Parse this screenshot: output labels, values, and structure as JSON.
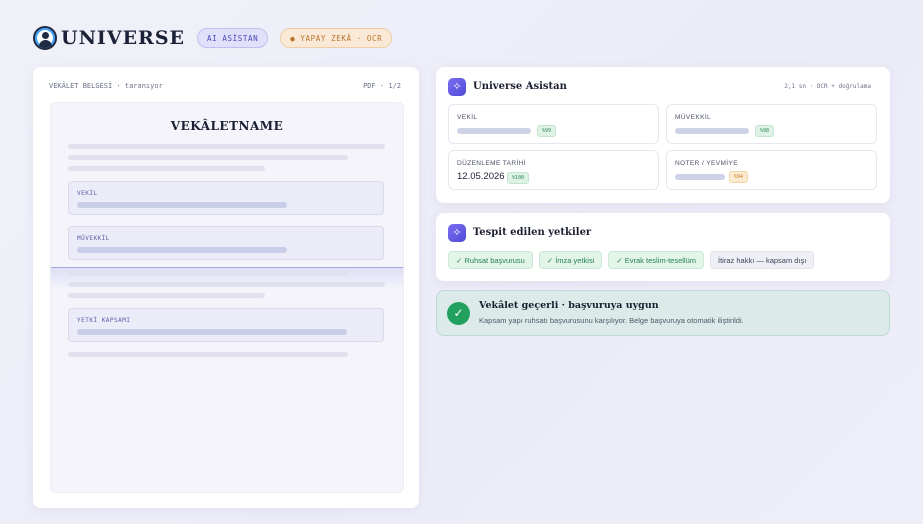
{
  "header": {
    "brand": "UNIVERSE",
    "badge_ai": "AI ASİSTAN",
    "badge_ocr": "● YAPAY ZEKÂ · OCR"
  },
  "document": {
    "status": "VEKÂLET BELGESİ · taranıyor",
    "pages": "PDF · 1/2",
    "title": "VEKÂLETNAME",
    "fields": [
      {
        "label": "VEKİL"
      },
      {
        "label": "MÜVEKKİL"
      },
      {
        "label": "YETKİ KAPSAMI"
      }
    ]
  },
  "assistant": {
    "title": "Universe Asistan",
    "meta": "2,1 sn · OCR + doğrulama",
    "icon": "sparkle-icon",
    "fields": [
      {
        "label": "VEKİL",
        "badge": "%99"
      },
      {
        "label": "MÜVEKKİL",
        "badge": "%98"
      },
      {
        "label": "DÜZENLEME TARİHİ",
        "value": "12.05.2026",
        "badge": "%100"
      },
      {
        "label": "NOTER / YEVMİYE",
        "badge": "%94"
      }
    ]
  },
  "authorities": {
    "title": "Tespit edilen yetkiler",
    "chips": [
      {
        "label": "✓ Ruhsat başvurusu",
        "status": "ok"
      },
      {
        "label": "✓ İmza yetkisi",
        "status": "ok"
      },
      {
        "label": "✓ Evrak teslim-tesellüm",
        "status": "ok"
      },
      {
        "label": "İtiraz hakkı — kapsam dışı",
        "status": "neutral"
      }
    ]
  },
  "result": {
    "title": "Vekâlet geçerli · başvuruya uygun",
    "description": "Kapsam yapı ruhsatı başvurusunu karşılıyor. Belge başvuruya otomatik iliştirildi.",
    "icon": "check-icon"
  },
  "colors": {
    "accent": "#5b55e0",
    "success": "#21a05e",
    "warning": "#c27b1f"
  }
}
